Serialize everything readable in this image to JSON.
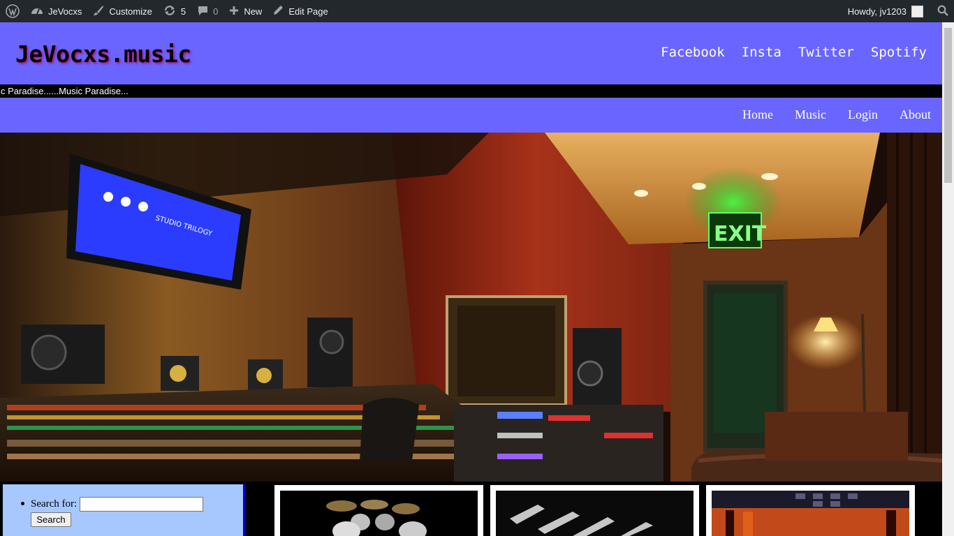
{
  "adminbar": {
    "site_name": "JeVocxs",
    "customize": "Customize",
    "updates_count": "5",
    "comments_count": "0",
    "new_label": "New",
    "edit_page": "Edit Page",
    "howdy": "Howdy, jv1203"
  },
  "header": {
    "site_title": "JeVocxs.music",
    "social": [
      "Facebook",
      "Insta",
      "Twitter",
      "Spotify"
    ]
  },
  "marquee": {
    "text": "c Paradise......Music Paradise..."
  },
  "nav": {
    "links": [
      "Home",
      "Music",
      "Login",
      "About"
    ]
  },
  "hero": {
    "screen_text": "STUDIO TRILOGY",
    "exit_sign": "EXIT"
  },
  "sidebar": {
    "search_label": "Search for:",
    "search_value": "",
    "search_button": "Search"
  },
  "colors": {
    "header_bg": "#6a65ff",
    "admin_bar": "#23282d",
    "sidebar_bg": "#a6c8ff",
    "sidebar_border": "#0000cc"
  }
}
